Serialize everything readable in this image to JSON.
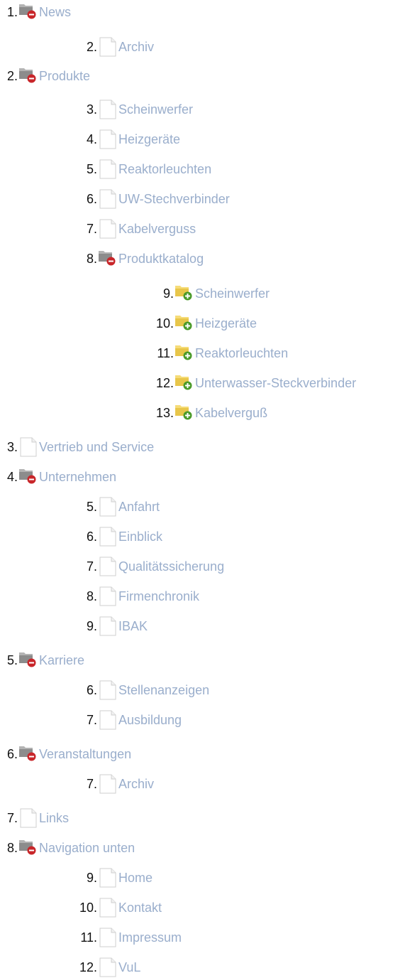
{
  "tree": [
    {
      "num": "1.",
      "label": "News",
      "icon": "folder-collapse-icon",
      "level": 0
    },
    {
      "num": "2.",
      "label": "Archiv",
      "icon": "page-icon",
      "level": 1
    },
    {
      "num": "2.",
      "label": "Produkte",
      "icon": "folder-collapse-icon",
      "level": 0
    },
    {
      "num": "3.",
      "label": "Scheinwerfer",
      "icon": "page-icon",
      "level": 1
    },
    {
      "num": "4.",
      "label": "Heizgeräte",
      "icon": "page-icon",
      "level": 1
    },
    {
      "num": "5.",
      "label": "Reaktorleuchten",
      "icon": "page-icon",
      "level": 1
    },
    {
      "num": "6.",
      "label": "UW-Stechverbinder",
      "icon": "page-icon",
      "level": 1
    },
    {
      "num": "7.",
      "label": "Kabelverguss",
      "icon": "page-icon",
      "level": 1
    },
    {
      "num": "8.",
      "label": "Produktkatalog",
      "icon": "folder-collapse-icon",
      "level": 1
    },
    {
      "num": "9.",
      "label": "Scheinwerfer",
      "icon": "folder-expand-icon",
      "level": 2
    },
    {
      "num": "10.",
      "label": "Heizgeräte",
      "icon": "folder-expand-icon",
      "level": 2
    },
    {
      "num": "11.",
      "label": "Reaktorleuchten",
      "icon": "folder-expand-icon",
      "level": 2
    },
    {
      "num": "12.",
      "label": "Unterwasser-Steckverbinder",
      "icon": "folder-expand-icon",
      "level": 2
    },
    {
      "num": "13.",
      "label": "Kabelverguß",
      "icon": "folder-expand-icon",
      "level": 2
    },
    {
      "num": "3.",
      "label": "Vertrieb und Service",
      "icon": "page-icon",
      "level": 0
    },
    {
      "num": "4.",
      "label": "Unternehmen",
      "icon": "folder-collapse-icon",
      "level": 0
    },
    {
      "num": "5.",
      "label": "Anfahrt",
      "icon": "page-icon",
      "level": 1
    },
    {
      "num": "6.",
      "label": "Einblick",
      "icon": "page-icon",
      "level": 1
    },
    {
      "num": "7.",
      "label": "Qualitätssicherung",
      "icon": "page-icon",
      "level": 1
    },
    {
      "num": "8.",
      "label": "Firmenchronik",
      "icon": "page-icon",
      "level": 1
    },
    {
      "num": "9.",
      "label": "IBAK",
      "icon": "page-icon",
      "level": 1
    },
    {
      "num": "5.",
      "label": "Karriere",
      "icon": "folder-collapse-icon",
      "level": 0
    },
    {
      "num": "6.",
      "label": "Stellenanzeigen",
      "icon": "page-icon",
      "level": 1
    },
    {
      "num": "7.",
      "label": "Ausbildung",
      "icon": "page-icon",
      "level": 1
    },
    {
      "num": "6.",
      "label": "Veranstaltungen",
      "icon": "folder-collapse-icon",
      "level": 0
    },
    {
      "num": "7.",
      "label": "Archiv",
      "icon": "page-icon",
      "level": 1
    },
    {
      "num": "7.",
      "label": "Links",
      "icon": "page-icon",
      "level": 0
    },
    {
      "num": "8.",
      "label": "Navigation unten",
      "icon": "folder-collapse-icon",
      "level": 0
    },
    {
      "num": "9.",
      "label": "Home",
      "icon": "page-icon",
      "level": 1
    },
    {
      "num": "10.",
      "label": "Kontakt",
      "icon": "page-icon",
      "level": 1
    },
    {
      "num": "11.",
      "label": "Impressum",
      "icon": "page-icon",
      "level": 1
    },
    {
      "num": "12.",
      "label": "VuL",
      "icon": "page-icon",
      "level": 1
    }
  ],
  "colors": {
    "link": "#9aaecc",
    "number": "#111111",
    "folder_grey": "#8c8c8c",
    "folder_yellow": "#e8c64a",
    "minus_badge": "#c8262a",
    "plus_badge": "#4a9a28"
  }
}
